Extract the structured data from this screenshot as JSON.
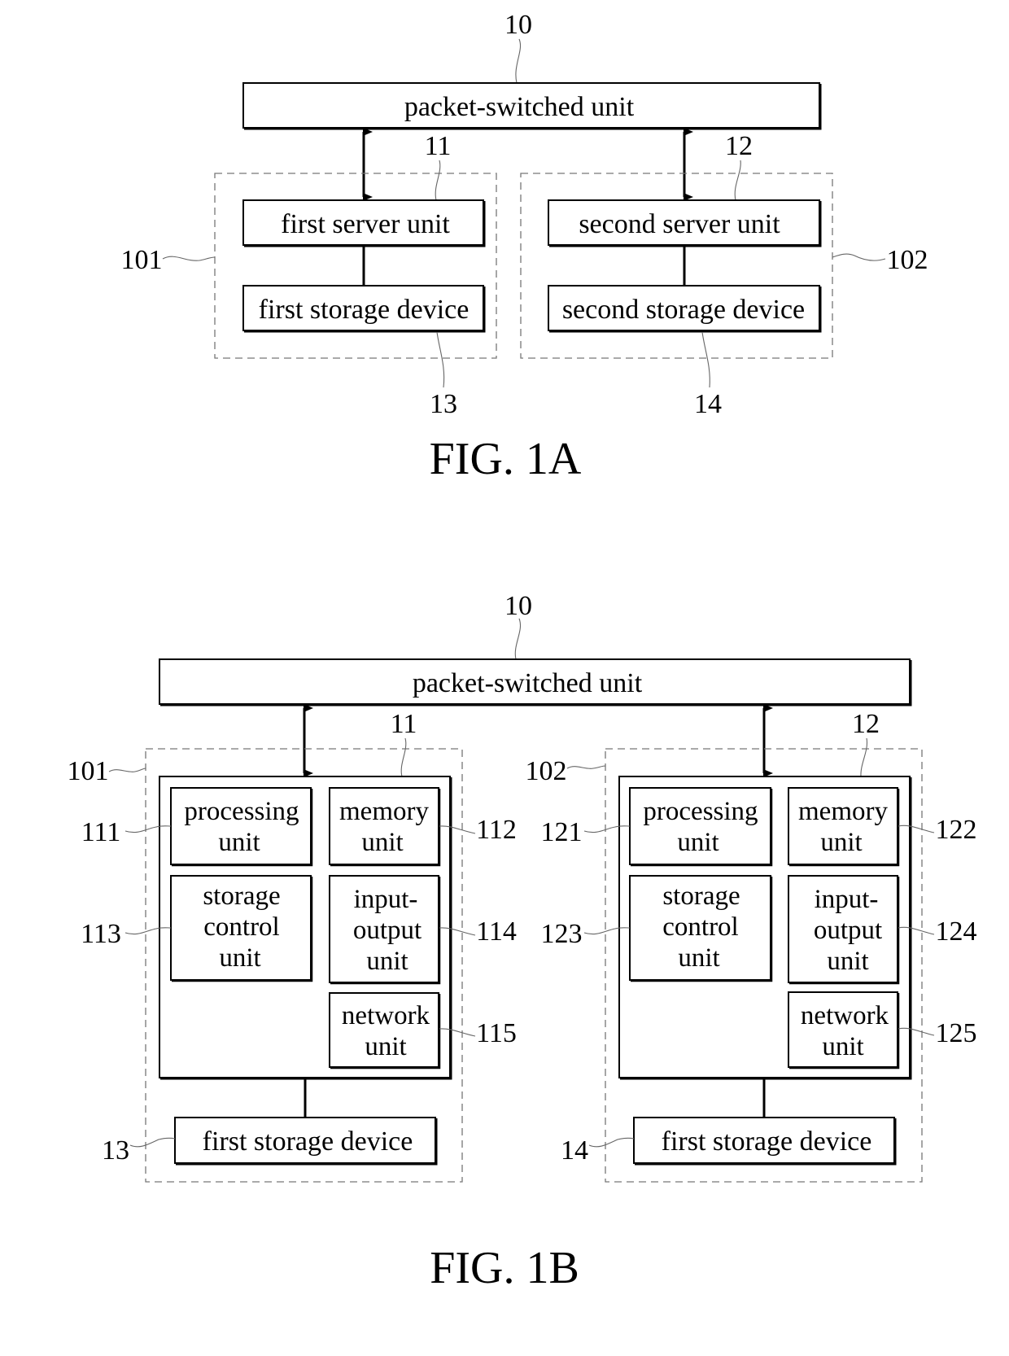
{
  "figures": [
    {
      "caption": "FIG. 1A",
      "packet_switched": {
        "ref": "10",
        "label": "packet-switched unit"
      },
      "groups": [
        {
          "ref": "101",
          "server": {
            "ref": "11",
            "label": "first server unit"
          },
          "storage": {
            "ref": "13",
            "label": "first storage device"
          }
        },
        {
          "ref": "102",
          "server": {
            "ref": "12",
            "label": "second server unit"
          },
          "storage": {
            "ref": "14",
            "label": "second storage device"
          }
        }
      ]
    },
    {
      "caption": "FIG. 1B",
      "packet_switched": {
        "ref": "10",
        "label": "packet-switched unit"
      },
      "groups": [
        {
          "ref": "101",
          "server_ref": "11",
          "components": [
            {
              "ref": "111",
              "lines": [
                "processing",
                "unit"
              ]
            },
            {
              "ref": "112",
              "lines": [
                "memory",
                "unit"
              ]
            },
            {
              "ref": "113",
              "lines": [
                "storage",
                "control",
                "unit"
              ]
            },
            {
              "ref": "114",
              "lines": [
                "input-",
                "output",
                "unit"
              ]
            },
            {
              "ref": "115",
              "lines": [
                "network",
                "unit"
              ]
            }
          ],
          "storage": {
            "ref": "13",
            "label": "first storage device"
          }
        },
        {
          "ref": "102",
          "server_ref": "12",
          "components": [
            {
              "ref": "121",
              "lines": [
                "processing",
                "unit"
              ]
            },
            {
              "ref": "122",
              "lines": [
                "memory",
                "unit"
              ]
            },
            {
              "ref": "123",
              "lines": [
                "storage",
                "control",
                "unit"
              ]
            },
            {
              "ref": "124",
              "lines": [
                "input-",
                "output",
                "unit"
              ]
            },
            {
              "ref": "125",
              "lines": [
                "network",
                "unit"
              ]
            }
          ],
          "storage": {
            "ref": "14",
            "label": "first storage device"
          }
        }
      ]
    }
  ]
}
